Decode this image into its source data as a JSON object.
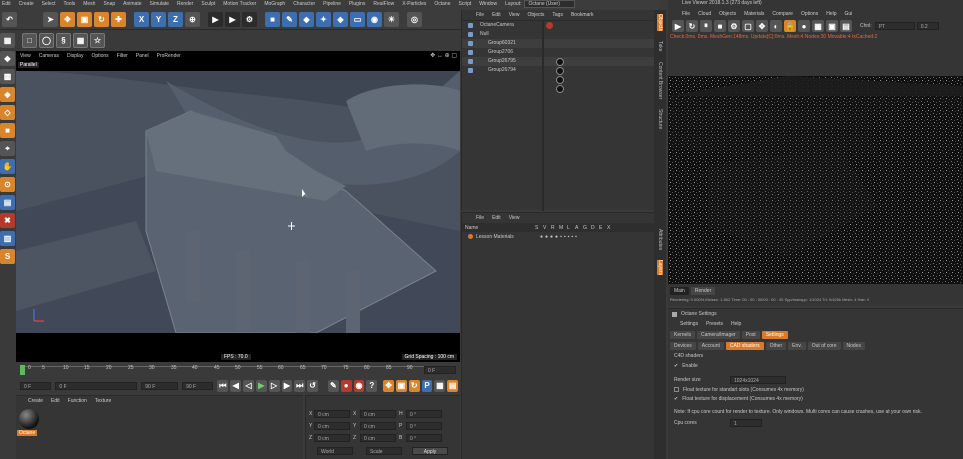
{
  "c4d_menu": [
    "Edit",
    "Create",
    "Select",
    "Tools",
    "Mesh",
    "Snap",
    "Animate",
    "Simulate",
    "Render",
    "Sculpt",
    "Motion Tracker",
    "MoGraph",
    "Character",
    "Pipeline",
    "Plugins",
    "RealFlow",
    "X-Particles",
    "Octane",
    "Script",
    "Window"
  ],
  "layout": {
    "label": "Layout:",
    "value": "Octane (User)"
  },
  "axis_buttons": [
    "X",
    "Y",
    "Z"
  ],
  "viewport": {
    "menu": [
      "View",
      "Cameras",
      "Display",
      "Options",
      "Filter",
      "Panel",
      "ProRender"
    ],
    "label": "Parallel",
    "fps": "FPS : 70.0",
    "grid": "Grid Spacing : 100 cm"
  },
  "timeline": {
    "ticks": [
      "0",
      "5",
      "10",
      "15",
      "20",
      "25",
      "30",
      "35",
      "40",
      "45",
      "50",
      "55",
      "60",
      "65",
      "70",
      "75",
      "80",
      "85",
      "90"
    ],
    "frame_end": "0 F",
    "field_start": "0 F",
    "field_a": "0 F",
    "field_b": "90 F",
    "field_c": "90 F"
  },
  "materials": {
    "menu": [
      "Create",
      "Edit",
      "Function",
      "Texture"
    ],
    "material_name": "Octane"
  },
  "coords": {
    "rows": [
      [
        "X",
        "0 cm",
        "X",
        "0 cm",
        "H",
        "0 °"
      ],
      [
        "Y",
        "0 cm",
        "Y",
        "0 cm",
        "P",
        "0 °"
      ],
      [
        "Z",
        "0 cm",
        "Z",
        "0 cm",
        "B",
        "0 °"
      ]
    ],
    "mode1": "World",
    "mode2": "Scale",
    "apply": "Apply"
  },
  "objects": {
    "menu": [
      "File",
      "Edit",
      "View",
      "Objects",
      "Tags",
      "Bookmark"
    ],
    "items": [
      "OctaneCamera",
      "Null",
      "Group60321",
      "Group2706",
      "Group26795",
      "Group26794"
    ]
  },
  "layers": {
    "menu": [
      "File",
      "Edit",
      "View"
    ],
    "columns": [
      "Name",
      "S",
      "V",
      "R",
      "M",
      "L",
      "A",
      "G",
      "D",
      "E",
      "X"
    ],
    "item": "Lesson Materials"
  },
  "side_tabs": [
    "Objects",
    "Take",
    "Content Browser",
    "Structure",
    "Attributes",
    "Layers"
  ],
  "live_viewer": {
    "title": "Live Viewer 2018.1.3 (273 days left)",
    "menu": [
      "File",
      "Cloud",
      "Objects",
      "Materials",
      "Compare",
      "Options",
      "Help",
      "Gui"
    ],
    "chnl_label": "Chnl:",
    "chnl_value": "PT",
    "chnl_num": "0.2",
    "status_line": "Check:0ms. 0ms. MeshGen:148ms. Update[C]:0ms. Mesh:4 Nodes:30 Movable:4 txCached:2",
    "bottom_tabs": [
      "Main",
      "Render"
    ],
    "stats": "Rendering: 0.000%   Ms/sec: 1.502   Time: 00 : 00 : 00/00 : 00 : 40   Spp/maxspp: 1/1024   Tri: 0/420k   Mesh: 4   Hair: 0"
  },
  "octane_settings": {
    "title": "Octane Settings",
    "menu": [
      "Settings",
      "Presets",
      "Help"
    ],
    "tabs1": [
      "Kernels",
      "Camera/Imager",
      "Post",
      "Settings"
    ],
    "tabs2": [
      "Devices",
      "Account",
      "CAD shaders",
      "Other",
      "Env.",
      "Out of core",
      "Nodes"
    ],
    "section": "C4D shaders",
    "enable": "Enable",
    "render_size_label": "Render size",
    "render_size_value": "1024x1024",
    "float_std": "Float texture for standart slots (Consumes 4x memory)",
    "float_disp": "Float texture for displacement (Consumes 4x memory)",
    "note": "Note: If cpu core count for render to texture. Only windows. Multi cores can cause crashes, use at your own risk.",
    "cpu_label": "Cpu cores",
    "cpu_value": "1"
  },
  "colors": {
    "accent": "#d97a2a",
    "blue": "#3d6fb0"
  }
}
